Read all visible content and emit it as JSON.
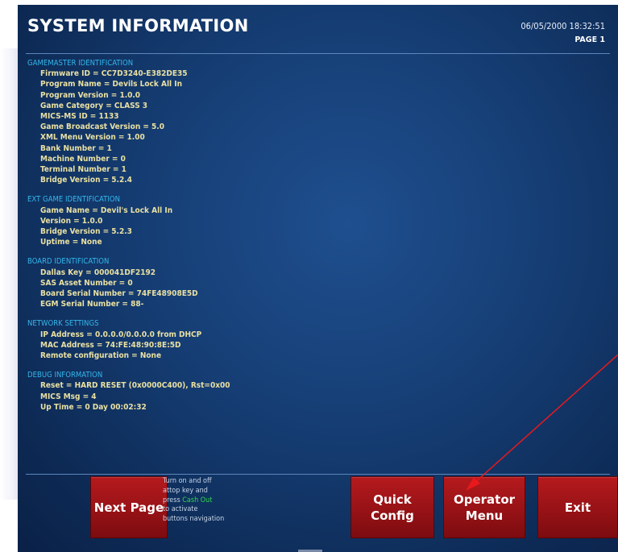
{
  "header": {
    "title": "SYSTEM INFORMATION",
    "datetime": "06/05/2000 18:32:51",
    "page": "PAGE 1"
  },
  "sections": [
    {
      "title": "GAMEMASTER IDENTIFICATION",
      "items": [
        "Firmware ID = CC7D3240-E382DE35",
        "Program Name = Devils Lock All In",
        "Program Version = 1.0.0",
        "Game Category = CLASS 3",
        "MICS-MS ID = 1133",
        "Game Broadcast Version = 5.0",
        "XML Menu Version = 1.00",
        "Bank Number = 1",
        "Machine Number = 0",
        "Terminal Number = 1",
        "Bridge Version = 5.2.4"
      ]
    },
    {
      "title": "EXT GAME IDENTIFICATION",
      "items": [
        "Game Name = Devil's Lock All In",
        "Version = 1.0.0",
        "Bridge Version = 5.2.3",
        "Uptime = None"
      ]
    },
    {
      "title": "BOARD IDENTIFICATION",
      "items": [
        "Dallas Key = 000041DF2192",
        "SAS Asset Number = 0",
        "Board Serial Number = 74FE48908E5D",
        "EGM Serial Number = 88-"
      ]
    },
    {
      "title": "NETWORK SETTINGS",
      "items": [
        "IP Address = 0.0.0.0/0.0.0.0 from DHCP",
        "MAC Address = 74:FE:48:90:8E:5D",
        "Remote configuration = None"
      ]
    },
    {
      "title": "DEBUG INFORMATION",
      "items": [
        "Reset = HARD RESET (0x0000C400), Rst=0x00",
        "MICS Msg = 4",
        "Up Time = 0 Day 00:02:32"
      ]
    }
  ],
  "buttons": {
    "next_page": "Next Page",
    "quick_config_line1": "Quick",
    "quick_config_line2": "Config",
    "operator_menu_line1": "Operator",
    "operator_menu_line2": "Menu",
    "exit": "Exit"
  },
  "hint": {
    "line1": "Turn on and off",
    "line2": "attop key and",
    "line3_prefix": "press ",
    "line3_highlight": "Cash Out",
    "line4": "to activate",
    "line5": "buttons navigation"
  },
  "annotation": {
    "arrow_color": "#e8191c"
  }
}
